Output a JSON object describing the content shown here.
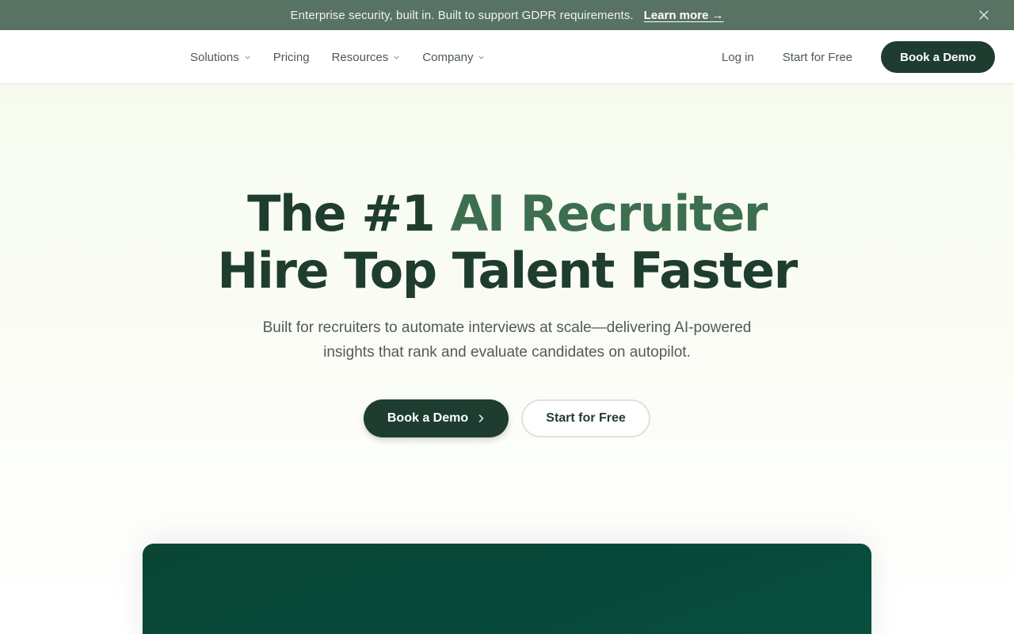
{
  "announcement": {
    "message": "Enterprise security, built in. Built to support GDPR requirements.",
    "link_label": "Learn more →",
    "close_icon": "close-icon"
  },
  "nav": {
    "items": [
      {
        "label": "Solutions",
        "has_dropdown": true
      },
      {
        "label": "Pricing",
        "has_dropdown": false
      },
      {
        "label": "Resources",
        "has_dropdown": true
      },
      {
        "label": "Company",
        "has_dropdown": true
      }
    ],
    "login_label": "Log in",
    "start_free_label": "Start for Free",
    "book_demo_label": "Book a Demo"
  },
  "hero": {
    "headline_part1": "The #1 ",
    "headline_accent": "AI Recruiter",
    "headline_line2": "Hire Top Talent Faster",
    "subtext_line1": "Built for recruiters to automate interviews at scale—delivering AI-powered",
    "subtext_line2": "insights that rank and evaluate candidates on autopilot.",
    "primary_cta": "Book a Demo",
    "secondary_cta": "Start for Free"
  },
  "colors": {
    "announce_bg": "#587263",
    "brand_dark": "#1e3d30",
    "headline_accent": "#3d6e50",
    "preview_bg": "#0b4634"
  }
}
